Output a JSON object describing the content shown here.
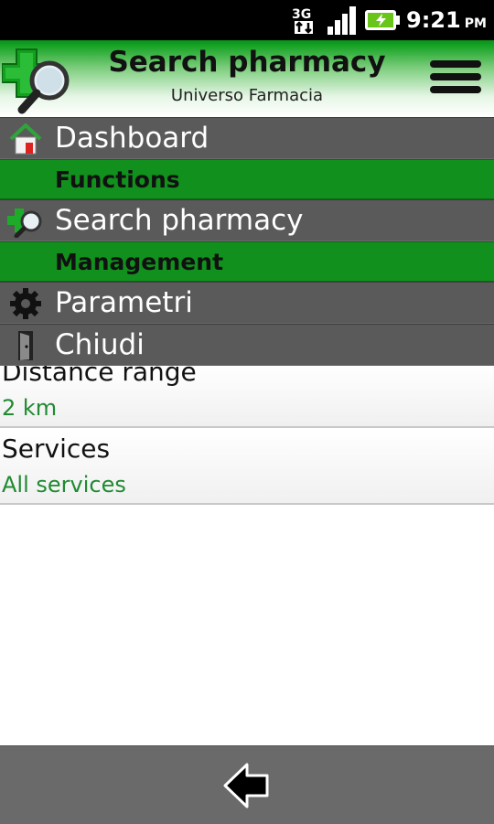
{
  "status_bar": {
    "network": "3G",
    "time": "9:21",
    "ampm": "PM"
  },
  "header": {
    "title": "Search pharmacy",
    "subtitle": "Universo Farmacia",
    "logo_icon": "pharmacy-cross-magnifier-icon",
    "menu_icon": "hamburger-menu-icon"
  },
  "menu": {
    "dashboard": {
      "label": "Dashboard",
      "icon": "house-icon"
    },
    "section_functions": "Functions",
    "search_pharmacy": {
      "label": "Search pharmacy",
      "icon": "pharmacy-search-icon"
    },
    "section_management": "Management",
    "parametri": {
      "label": "Parametri",
      "icon": "gear-icon"
    },
    "chiudi": {
      "label": "Chiudi",
      "icon": "door-exit-icon"
    }
  },
  "settings": {
    "distance": {
      "title": "Distance range",
      "value": "2 km"
    },
    "services": {
      "title": "Services",
      "value": "All services"
    }
  },
  "bottom_bar": {
    "back_icon": "back-arrow-icon"
  },
  "colors": {
    "header_green": "#16a324",
    "section_green": "#11901d",
    "menu_gray": "#5a5a5a",
    "value_green": "#208a32",
    "bottom_gray": "#6a6a6a"
  }
}
